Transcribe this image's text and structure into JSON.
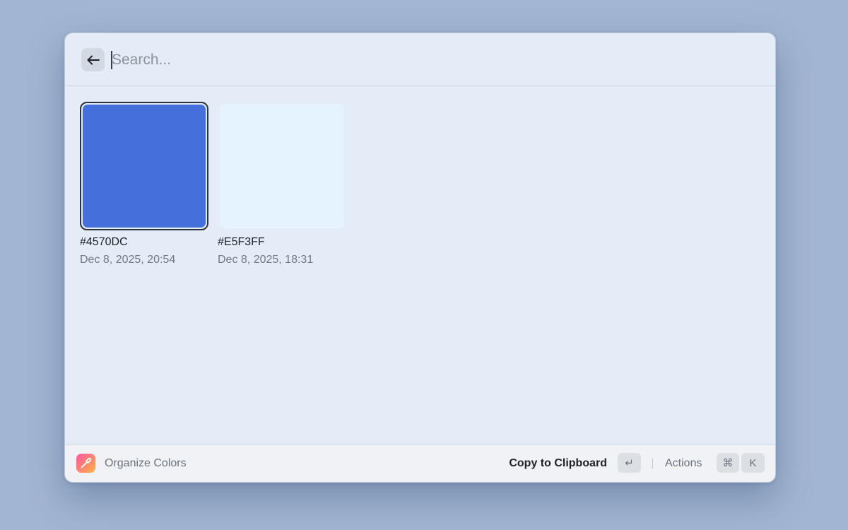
{
  "search": {
    "placeholder": "Search...",
    "value": ""
  },
  "colors": [
    {
      "hex": "#4570DC",
      "swatch": "#4570DC",
      "date": "Dec 8, 2025, 20:54",
      "selected": true
    },
    {
      "hex": "#E5F3FF",
      "swatch": "#E5F3FF",
      "date": "Dec 8, 2025, 18:31",
      "selected": false
    }
  ],
  "footer": {
    "title": "Organize Colors",
    "primary_action": "Copy to Clipboard",
    "enter_key": "↵",
    "actions_label": "Actions",
    "cmd_key": "⌘",
    "k_key": "K"
  },
  "icons": {
    "back": "arrow-left-icon",
    "app": "color-picker-icon"
  }
}
